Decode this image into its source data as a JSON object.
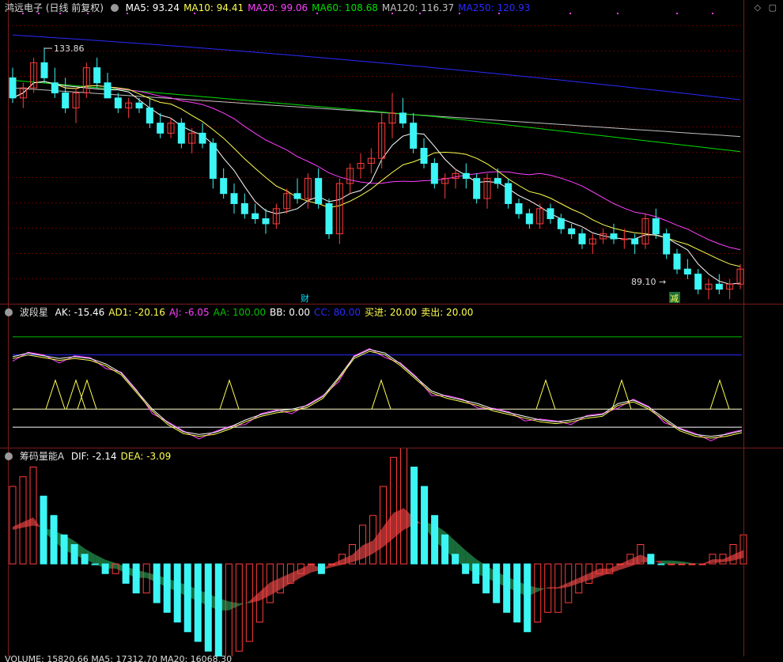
{
  "colors": {
    "bg": "#000000",
    "up": "#ff3c3c",
    "down": "#3cf5f5",
    "grid": "#5a0000",
    "ma5": "#ffffff",
    "ma10": "#ffff50",
    "ma20": "#ff40ff",
    "ma60": "#00e000",
    "ma120": "#c0c0c0",
    "ma250": "#2a2aff",
    "green_fill": "#1a6b3a",
    "red_fill": "#a03030",
    "ak": "#ffffff",
    "ad1": "#ffff50",
    "aj": "#ff40ff",
    "aa": "#00c000",
    "bb": "#ffffff",
    "cc": "#2a2aff"
  },
  "main": {
    "title": "鸿远电子 (日线 前复权)",
    "indicators": [
      {
        "label": "MA5: 93.24",
        "color": "#ffffff"
      },
      {
        "label": "MA10: 94.41",
        "color": "#ffff50"
      },
      {
        "label": "MA20: 99.06",
        "color": "#ff40ff"
      },
      {
        "label": "MA60: 108.68",
        "color": "#00e000"
      },
      {
        "label": "MA120: 116.37",
        "color": "#c0c0c0"
      },
      {
        "label": "MA250: 120.93",
        "color": "#2a2aff"
      }
    ],
    "high_label": "133.86",
    "low_label": "89.10",
    "marker_cai": "财",
    "marker_jian": "减",
    "icons": [
      "diamond-icon",
      "box-icon"
    ]
  },
  "wave": {
    "title": "波段星",
    "indicators": [
      {
        "label": "AK: -15.46",
        "color": "#ffffff"
      },
      {
        "label": "AD1: -20.16",
        "color": "#ffff50"
      },
      {
        "label": "AJ: -6.05",
        "color": "#ff40ff"
      },
      {
        "label": "AA: 100.00",
        "color": "#00c000"
      },
      {
        "label": "BB: 0.00",
        "color": "#ffffff"
      },
      {
        "label": "CC: 80.00",
        "color": "#2a2aff"
      },
      {
        "label": "买进: 20.00",
        "color": "#ffff50"
      },
      {
        "label": "卖出: 20.00",
        "color": "#ffff50"
      }
    ]
  },
  "macd": {
    "title": "筹码量能A",
    "indicators": [
      {
        "label": "DIF: -2.14",
        "color": "#ffffff"
      },
      {
        "label": "DEA: -3.09",
        "color": "#ffff50"
      }
    ]
  },
  "volume": {
    "label": "VOLUME: 15820.66  MA5: 17312.70  MA20: 16068.30"
  },
  "chart_data": [
    {
      "type": "candlestick",
      "title": "鸿远电子 (日线 前复权)",
      "ylim": [
        85,
        140
      ],
      "ohlc": [
        [
          128,
          130,
          123,
          124
        ],
        [
          124,
          127,
          122,
          126
        ],
        [
          126,
          132,
          125,
          131
        ],
        [
          131,
          134,
          127,
          128
        ],
        [
          127,
          130,
          124,
          125
        ],
        [
          125,
          128,
          121,
          122
        ],
        [
          122,
          126,
          119,
          125
        ],
        [
          125,
          131,
          124,
          130
        ],
        [
          130,
          132,
          126,
          127
        ],
        [
          127,
          129,
          124,
          124
        ],
        [
          124,
          125,
          121,
          122
        ],
        [
          122,
          124,
          120,
          123
        ],
        [
          123,
          124,
          121,
          122
        ],
        [
          122,
          124,
          118,
          119
        ],
        [
          119,
          121,
          116,
          117
        ],
        [
          117,
          120,
          116,
          119
        ],
        [
          119,
          120,
          114,
          115
        ],
        [
          115,
          118,
          113,
          117
        ],
        [
          117,
          119,
          114,
          115
        ],
        [
          115,
          116,
          106,
          108
        ],
        [
          108,
          110,
          104,
          105
        ],
        [
          105,
          107,
          101,
          103
        ],
        [
          103,
          105,
          100,
          101
        ],
        [
          101,
          103,
          99,
          100
        ],
        [
          100,
          102,
          97,
          99
        ],
        [
          99,
          103,
          98,
          102
        ],
        [
          102,
          106,
          101,
          105
        ],
        [
          105,
          108,
          103,
          104
        ],
        [
          104,
          109,
          102,
          108
        ],
        [
          108,
          110,
          102,
          103
        ],
        [
          103,
          104,
          96,
          97
        ],
        [
          97,
          108,
          95,
          107
        ],
        [
          107,
          111,
          105,
          110
        ],
        [
          110,
          113,
          108,
          111
        ],
        [
          111,
          114,
          109,
          112
        ],
        [
          112,
          121,
          110,
          119
        ],
        [
          119,
          125,
          116,
          121
        ],
        [
          121,
          124,
          118,
          119
        ],
        [
          119,
          121,
          113,
          114
        ],
        [
          114,
          116,
          110,
          111
        ],
        [
          111,
          112,
          106,
          107
        ],
        [
          107,
          109,
          104,
          108
        ],
        [
          108,
          110,
          106,
          109
        ],
        [
          109,
          111,
          106,
          108
        ],
        [
          108,
          109,
          103,
          104
        ],
        [
          104,
          109,
          102,
          108
        ],
        [
          108,
          110,
          106,
          107
        ],
        [
          107,
          108,
          102,
          103
        ],
        [
          103,
          104,
          100,
          101
        ],
        [
          101,
          102,
          98,
          99
        ],
        [
          99,
          103,
          98,
          102
        ],
        [
          102,
          103,
          99,
          100
        ],
        [
          100,
          101,
          97,
          98
        ],
        [
          98,
          99,
          96,
          97
        ],
        [
          97,
          98,
          94,
          95
        ],
        [
          95,
          97,
          93,
          96
        ],
        [
          96,
          98,
          95,
          97
        ],
        [
          97,
          99,
          95,
          96
        ],
        [
          96,
          98,
          94,
          96
        ],
        [
          96,
          97,
          93,
          95
        ],
        [
          95,
          101,
          94,
          100
        ],
        [
          100,
          102,
          96,
          97
        ],
        [
          97,
          98,
          92,
          93
        ],
        [
          93,
          94,
          89,
          90
        ],
        [
          90,
          92,
          88,
          89
        ],
        [
          89,
          90,
          85,
          86
        ],
        [
          86,
          88,
          84,
          87
        ],
        [
          87,
          89,
          85,
          86
        ],
        [
          86,
          88,
          84,
          87
        ],
        [
          87,
          91,
          86,
          90
        ]
      ],
      "series": [
        {
          "name": "MA5",
          "value": 93.24
        },
        {
          "name": "MA10",
          "value": 94.41
        },
        {
          "name": "MA20",
          "value": 99.06
        },
        {
          "name": "MA60",
          "value": 108.68
        },
        {
          "name": "MA120",
          "value": 116.37
        },
        {
          "name": "MA250",
          "value": 120.93
        }
      ],
      "high": 133.86,
      "low": 89.1
    },
    {
      "type": "line",
      "title": "波段星",
      "ylim": [
        -20,
        120
      ],
      "series": [
        {
          "name": "AK",
          "value": -15.46
        },
        {
          "name": "AD1",
          "value": -20.16
        },
        {
          "name": "AJ",
          "value": -6.05
        },
        {
          "name": "AA",
          "value": 100.0
        },
        {
          "name": "BB",
          "value": 0.0
        },
        {
          "name": "CC",
          "value": 80.0
        }
      ]
    },
    {
      "type": "bar",
      "title": "筹码量能A",
      "series": [
        {
          "name": "DIF",
          "value": -2.14
        },
        {
          "name": "DEA",
          "value": -3.09
        }
      ],
      "values": [
        8,
        9,
        10,
        7,
        5,
        3,
        2,
        1,
        0,
        -1,
        -1,
        -2,
        -3,
        -3,
        -4,
        -5,
        -6,
        -7,
        -8,
        -9,
        -10,
        -10,
        -9,
        -8,
        -6,
        -4,
        -3,
        -2,
        -1,
        0,
        -1,
        0,
        1,
        2,
        4,
        5,
        8,
        11,
        12,
        10,
        8,
        5,
        3,
        1,
        -1,
        -2,
        -3,
        -4,
        -5,
        -6,
        -7,
        -6,
        -5,
        -5,
        -4,
        -3,
        -2,
        -1,
        -1,
        0,
        1,
        2,
        1,
        0,
        0,
        0,
        0,
        0,
        1,
        1,
        2,
        3
      ]
    }
  ]
}
